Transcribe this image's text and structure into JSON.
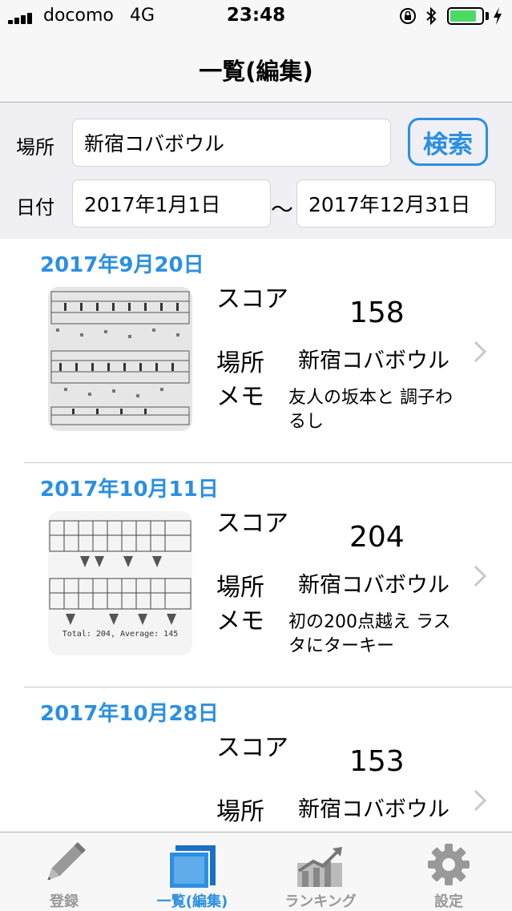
{
  "status_bar": {
    "carrier": "docomo",
    "network": "4G",
    "time": "23:48",
    "battery_level": 0.85
  },
  "nav": {
    "title": "一覧(編集)"
  },
  "filter": {
    "place_label": "場所",
    "place_value": "新宿コバボウル",
    "search_label": "検索",
    "date_label": "日付",
    "date_from": "2017年1月1日",
    "tilde": "～",
    "date_to": "2017年12月31日"
  },
  "list": {
    "score_label": "スコア",
    "place_label": "場所",
    "memo_label": "メモ",
    "items": [
      {
        "date": "2017年9月20日",
        "score": "158",
        "place": "新宿コバボウル",
        "memo": "友人の坂本と 調子わるし"
      },
      {
        "date": "2017年10月11日",
        "score": "204",
        "place": "新宿コバボウル",
        "memo": "初の200点越え ラスタにターキー",
        "thumb_caption": "Total: 204, Average: 145"
      },
      {
        "date": "2017年10月28日",
        "score": "153",
        "place": "新宿コバボウル",
        "memo": ""
      }
    ]
  },
  "tabs": [
    {
      "label": "登録",
      "icon": "pencil-icon",
      "active": false
    },
    {
      "label": "一覧(編集)",
      "icon": "list-icon",
      "active": true
    },
    {
      "label": "ランキング",
      "icon": "chart-icon",
      "active": false
    },
    {
      "label": "設定",
      "icon": "gear-icon",
      "active": false
    }
  ],
  "colors": {
    "accent": "#2b8fe2",
    "battery": "#4cd964",
    "inactive_tab": "#999999"
  }
}
